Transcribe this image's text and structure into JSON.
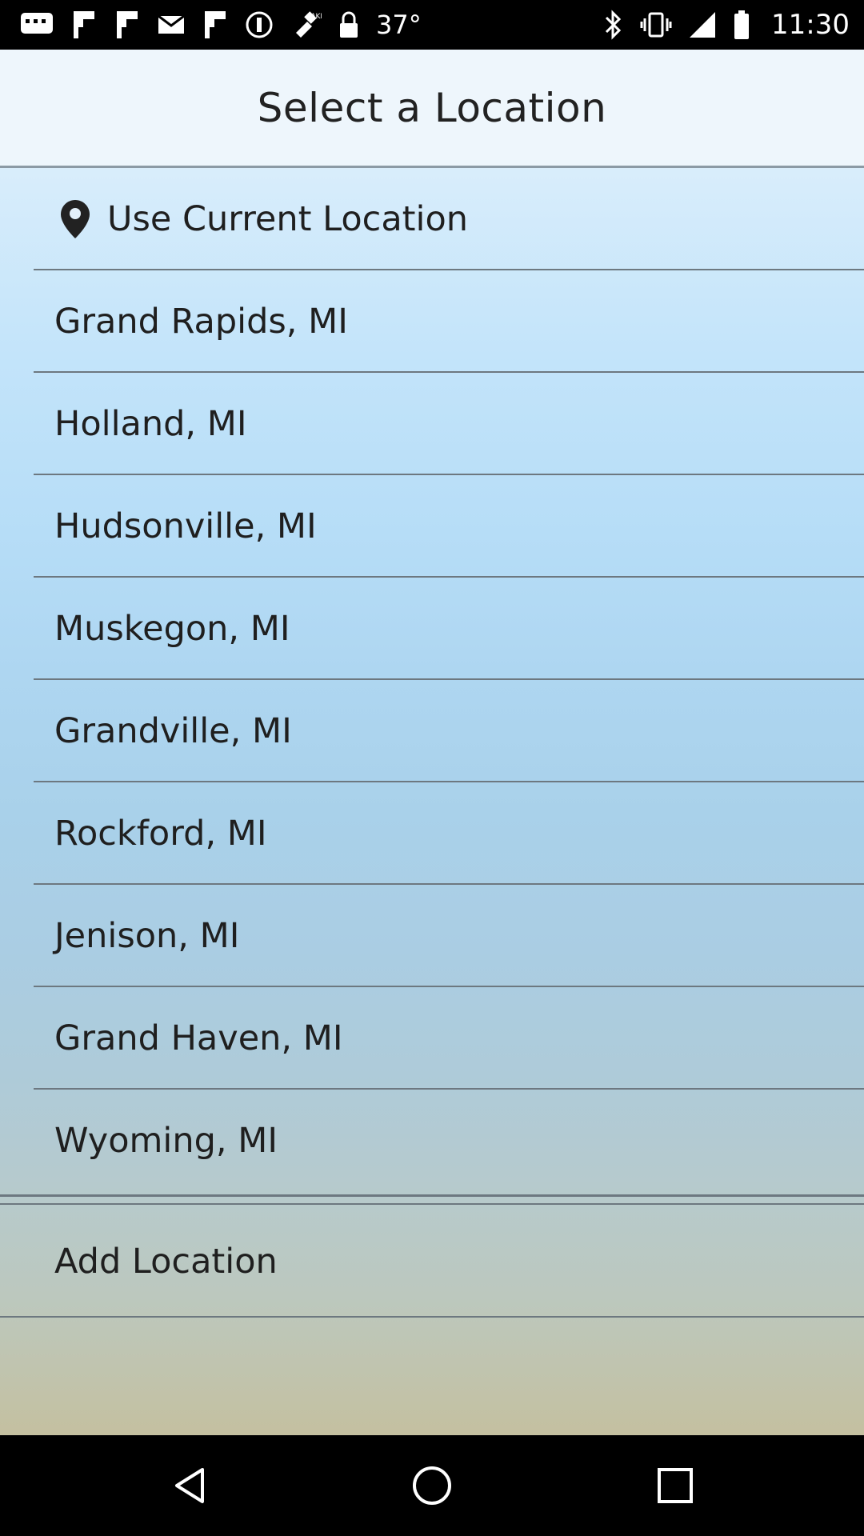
{
  "status_bar": {
    "temperature": "37°",
    "time": "11:30",
    "left_icons": [
      "message-icon",
      "flipboard-icon",
      "flipboard-icon",
      "mail-icon",
      "flipboard-icon",
      "disney-icon",
      "fake-gps-icon",
      "lock-icon"
    ],
    "right_icons": [
      "bluetooth-icon",
      "vibrate-icon",
      "signal-icon",
      "battery-icon"
    ]
  },
  "header": {
    "title": "Select a Location"
  },
  "current_location": {
    "label": "Use Current Location",
    "icon": "location-pin-icon"
  },
  "locations": [
    {
      "label": "Grand Rapids, MI"
    },
    {
      "label": "Holland, MI"
    },
    {
      "label": "Hudsonville, MI"
    },
    {
      "label": "Muskegon, MI"
    },
    {
      "label": "Grandville, MI"
    },
    {
      "label": "Rockford, MI"
    },
    {
      "label": "Jenison, MI"
    },
    {
      "label": "Grand Haven, MI"
    },
    {
      "label": "Wyoming, MI"
    }
  ],
  "add_location": {
    "label": "Add Location"
  },
  "nav_bar": {
    "buttons": [
      "back-icon",
      "home-icon",
      "recents-icon"
    ]
  },
  "colors": {
    "header_bg": "#eef6fc",
    "divider": "#6d7880",
    "text": "#1f1f1f"
  }
}
